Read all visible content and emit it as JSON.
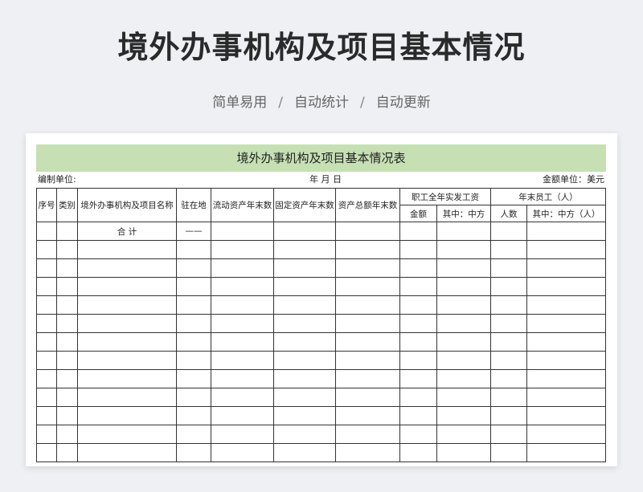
{
  "page": {
    "title": "境外办事机构及项目基本情况",
    "tags": [
      "简单易用",
      "自动统计",
      "自动更新"
    ],
    "separator": "/"
  },
  "sheet": {
    "title": "境外办事机构及项目基本情况表",
    "unit_label": "编制单位:",
    "date_label": "年 月 日",
    "currency_label": "金额单位：美元",
    "headers": {
      "seq": "序号",
      "category": "类别",
      "name": "境外办事机构及项目名称",
      "location": "驻在地",
      "current_assets": "流动资产年末数",
      "fixed_assets": "固定资产年末数",
      "total_assets": "资产总额年末数",
      "wages_group": "职工全年实发工资",
      "wages_amount": "金额",
      "wages_chinese": "其中：中方",
      "staff_group": "年末员工（人）",
      "staff_count": "人数",
      "staff_chinese": "其中：中方（人）"
    },
    "total_row": {
      "label": "合 计",
      "location": "——"
    },
    "blank_rows": 12
  }
}
